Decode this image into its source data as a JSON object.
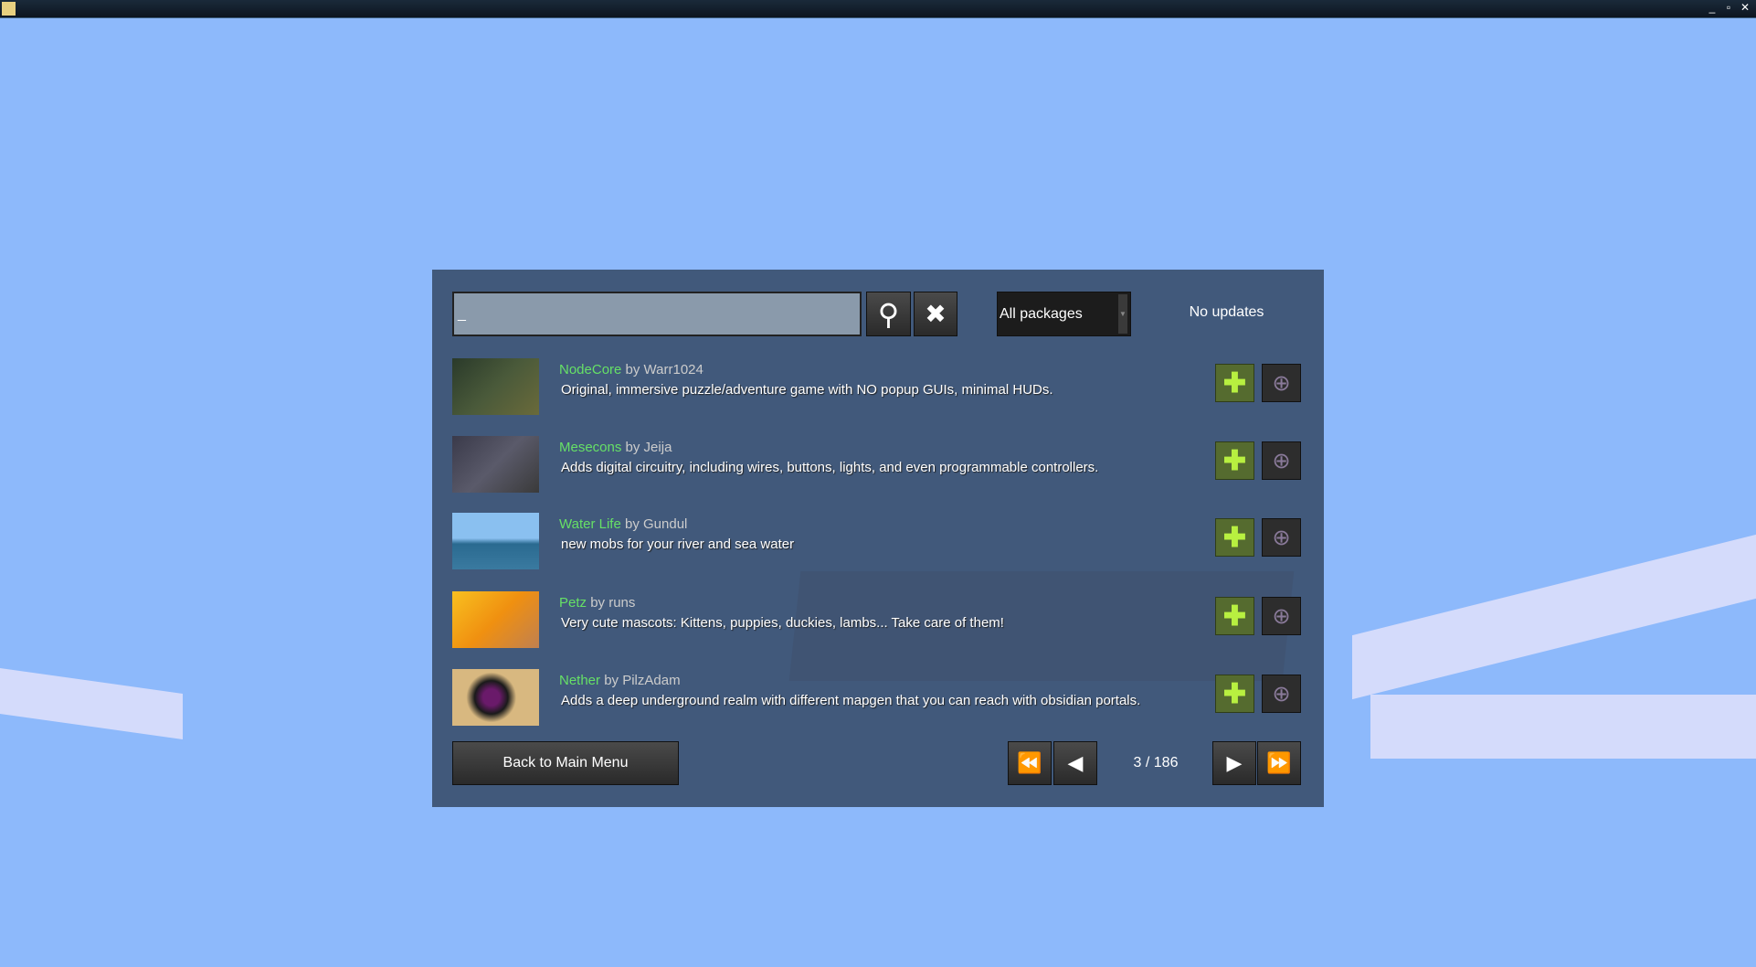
{
  "search": {
    "value": "_",
    "placeholder": ""
  },
  "filter": {
    "selected": "All packages"
  },
  "status": "No updates",
  "packages": [
    {
      "name": "NodeCore",
      "by": "by Warr1024",
      "description": "Original, immersive puzzle/adventure game with NO popup GUIs, minimal HUDs.",
      "thumb_color": "#3a4a2a"
    },
    {
      "name": "Mesecons",
      "by": "by Jeija",
      "description": "Adds digital circuitry, including wires, buttons, lights, and even programmable controllers.",
      "thumb_color": "#4a4a5a"
    },
    {
      "name": "Water Life",
      "by": "by Gundul",
      "description": "new mobs for your river and sea water",
      "thumb_color": "#4a8ab0"
    },
    {
      "name": "Petz",
      "by": "by runs",
      "description": "Very cute mascots: Kittens, puppies, duckies, lambs... Take care of them!",
      "thumb_color": "#f0a020"
    },
    {
      "name": "Nether",
      "by": "by PilzAdam",
      "description": "Adds a deep underground realm with different mapgen that you can reach with obsidian portals.",
      "thumb_color": "#c8a870"
    }
  ],
  "footer": {
    "back_label": "Back to Main Menu",
    "page": "3 / 186"
  },
  "icons": {
    "search": "⚲",
    "clear": "✖",
    "add": "✚",
    "web": "⊕",
    "first": "⏪",
    "prev": "◀",
    "next": "▶",
    "last": "⏩"
  },
  "colors": {
    "title": "#66e066",
    "panel": "#374b69",
    "sky": "#8db9fb"
  }
}
